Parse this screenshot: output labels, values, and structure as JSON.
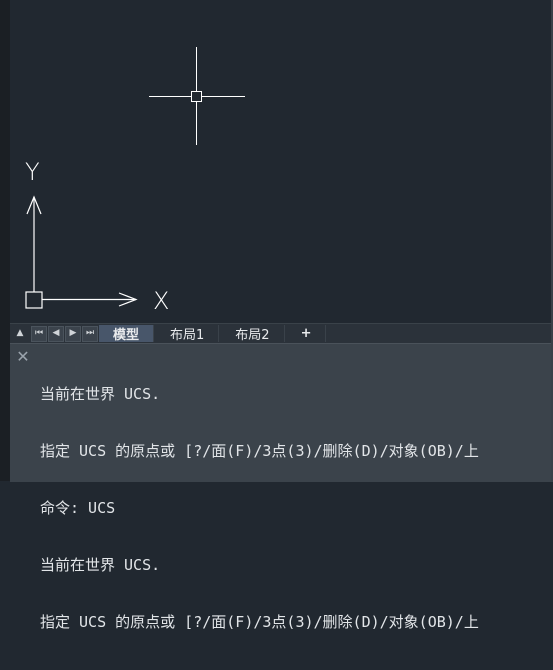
{
  "axes": {
    "x_label": "X",
    "y_label": "Y"
  },
  "tabs": {
    "nav": [
      "▲",
      "⏮",
      "◀",
      "▶",
      "⏭"
    ],
    "items": [
      {
        "label": "模型",
        "active": true
      },
      {
        "label": "布局1",
        "active": false
      },
      {
        "label": "布局2",
        "active": false
      }
    ],
    "add_label": "+"
  },
  "command": {
    "close_icon": "✕",
    "lines": [
      "当前在世界 UCS.",
      "指定 UCS 的原点或 [?/面(F)/3点(3)/删除(D)/对象(OB)/上",
      "命令: UCS",
      "当前在世界 UCS.",
      "指定 UCS 的原点或 [?/面(F)/3点(3)/删除(D)/对象(OB)/上"
    ]
  },
  "colors": {
    "canvas": "#212830",
    "crosshair": "#ffffff",
    "active_tab": "#48566a",
    "command_bg": "#3b434b"
  }
}
